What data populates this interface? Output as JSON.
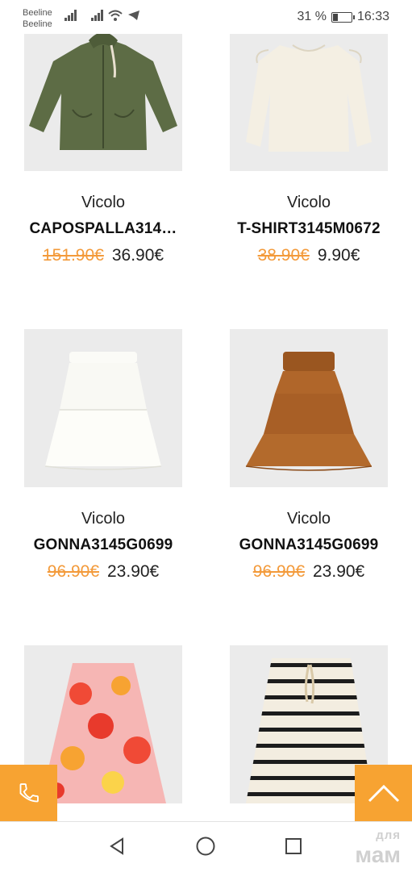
{
  "status_bar": {
    "carrier_1": "Beeline",
    "carrier_2": "Beeline",
    "battery_text": "31 %",
    "battery_level": 0.31,
    "time": "16:33"
  },
  "products": [
    {
      "brand": "Vicolo",
      "name": "CAPOSPALLA314…",
      "old_price": "151.90€",
      "new_price": "36.90€",
      "image": "olive-hooded-jacket"
    },
    {
      "brand": "Vicolo",
      "name": "T-SHIRT3145M0672",
      "old_price": "38.90€",
      "new_price": "9.90€",
      "image": "cream-long-sleeve-top"
    },
    {
      "brand": "Vicolo",
      "name": "GONNA3145G0699",
      "old_price": "96.90€",
      "new_price": "23.90€",
      "image": "white-tiered-skirt"
    },
    {
      "brand": "Vicolo",
      "name": "GONNA3145G0699",
      "old_price": "96.90€",
      "new_price": "23.90€",
      "image": "brown-tiered-skirt"
    },
    {
      "brand": "",
      "name": "",
      "old_price": "",
      "new_price": "",
      "image": "floral-print-skirt"
    },
    {
      "brand": "",
      "name": "",
      "old_price": "",
      "new_price": "",
      "image": "striped-skirt"
    }
  ],
  "fabs": {
    "call_icon": "phone-icon",
    "top_icon": "chevron-up-icon"
  },
  "navbar": {
    "back_icon": "back-triangle-icon",
    "home_icon": "home-circle-icon",
    "recents_icon": "recents-square-icon"
  },
  "watermark": {
    "line1": "для",
    "line2": "мам"
  },
  "colors": {
    "accent": "#f7a332",
    "old_price": "#f39a3a",
    "image_bg": "#ebebeb"
  }
}
